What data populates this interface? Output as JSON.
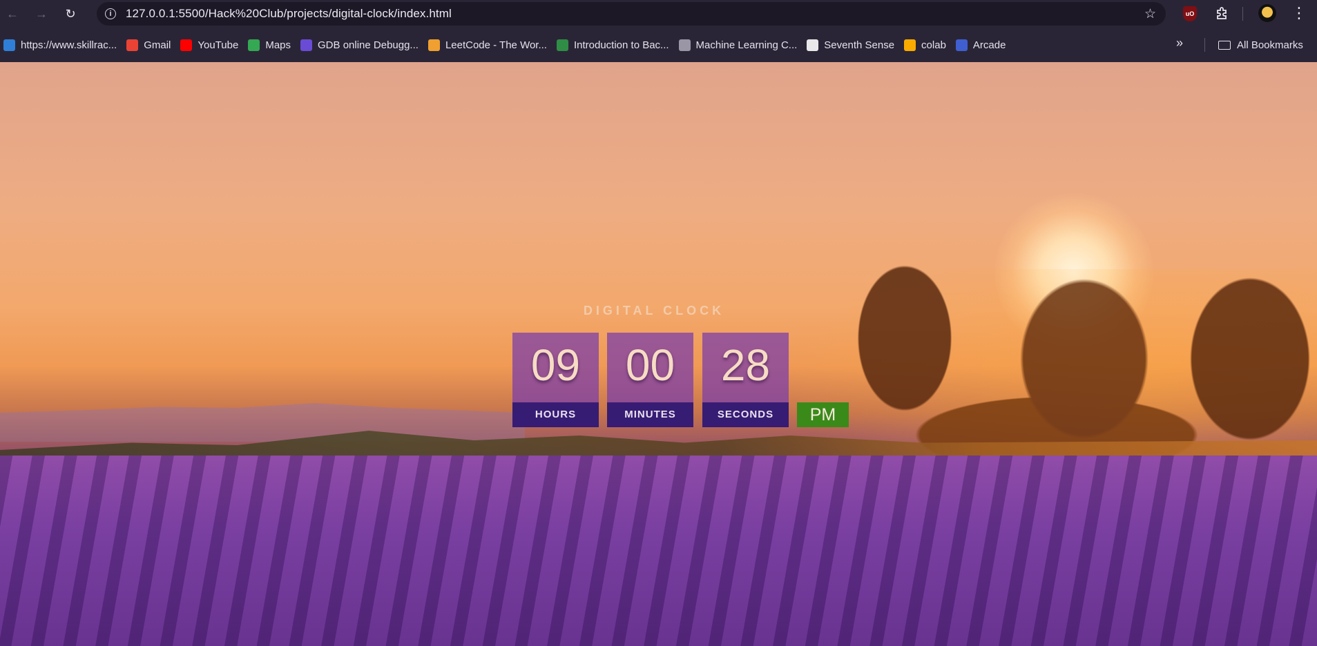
{
  "browser": {
    "url": "127.0.0.1:5500/Hack%20Club/projects/digital-clock/index.html",
    "ublock_badge": "uO"
  },
  "bookmarks": {
    "items": [
      {
        "label": "https://www.skillrac...",
        "icon": "skillrack-icon",
        "color": "#2f7fd8"
      },
      {
        "label": "Gmail",
        "icon": "gmail-icon",
        "color": "#ea4335"
      },
      {
        "label": "YouTube",
        "icon": "youtube-icon",
        "color": "#ff0000"
      },
      {
        "label": "Maps",
        "icon": "maps-icon",
        "color": "#34a853"
      },
      {
        "label": "GDB online Debugg...",
        "icon": "gdb-icon",
        "color": "#6a4bd6"
      },
      {
        "label": "LeetCode - The Wor...",
        "icon": "leetcode-icon",
        "color": "#f0a030"
      },
      {
        "label": "Introduction to Bac...",
        "icon": "geeksforgeeks-icon",
        "color": "#2f8d46"
      },
      {
        "label": "Machine Learning C...",
        "icon": "t-circle-icon",
        "color": "#9a96a6"
      },
      {
        "label": "Seventh Sense",
        "icon": "seventh-sense-icon",
        "color": "#e8e8e8"
      },
      {
        "label": "colab",
        "icon": "colab-icon",
        "color": "#f9ab00"
      },
      {
        "label": "Arcade",
        "icon": "arcade-icon",
        "color": "#3f5fd0"
      }
    ],
    "all_bookmarks": "All Bookmarks"
  },
  "clock": {
    "title": "DIGITAL CLOCK",
    "hours": "09",
    "minutes": "00",
    "seconds": "28",
    "hours_label": "HOURS",
    "minutes_label": "MINUTES",
    "seconds_label": "SECONDS",
    "ampm": "PM"
  }
}
